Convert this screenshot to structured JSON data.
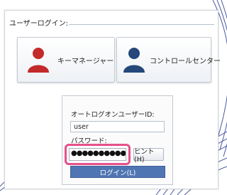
{
  "group": {
    "title": "ユーザーログイン:"
  },
  "tiles": [
    {
      "label": "キーマネージャー",
      "icon": "user-red-icon",
      "color": "#c32a2a"
    },
    {
      "label": "コントロールセンター",
      "icon": "user-blue-icon",
      "color": "#25477a"
    }
  ],
  "login": {
    "auto_login_label": "オートログオンユーザーID:",
    "user_value": "user",
    "password_label": "パスワード:",
    "password_value": "●●●●●●●●●●",
    "hint_label": "ヒント(H)",
    "login_button_label": "ログイン(L)"
  },
  "colors": {
    "highlight": "#e6518a",
    "login_button": "#4f76b3",
    "background_swirl": "#2b3d8f"
  }
}
